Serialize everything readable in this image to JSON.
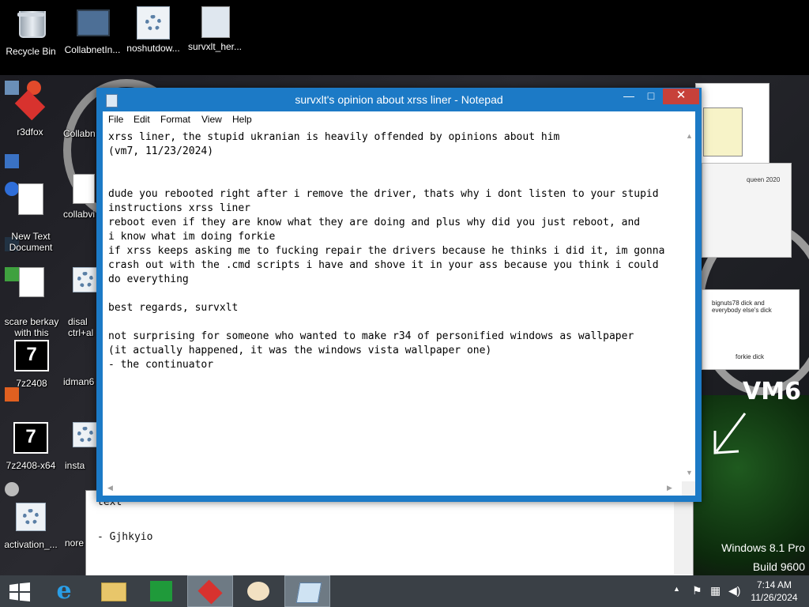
{
  "desktop": {
    "icons": [
      {
        "label": "Recycle Bin",
        "icon": "recycle-bin-icon"
      },
      {
        "label": "CollabnetIn...",
        "icon": "installer-icon"
      },
      {
        "label": "noshutdow...",
        "icon": "settings-gear-icon"
      },
      {
        "label": "survxlt_her...",
        "icon": "window-file-icon"
      }
    ],
    "side_icons": [
      {
        "label": "r3dfox"
      },
      {
        "label": "Collabn"
      },
      {
        "label": "New Text\nDocument"
      },
      {
        "label": "collabvi"
      },
      {
        "label": "scare berkay\nwith this"
      },
      {
        "label": "disal\nctrl+al"
      },
      {
        "label": "7z2408"
      },
      {
        "label": "idman6"
      },
      {
        "label": "7z2408-x64"
      },
      {
        "label": "insta"
      },
      {
        "label": "activation_..."
      },
      {
        "label": "nore"
      }
    ],
    "sketch_label": "VM6",
    "wallpaper_text": {
      "note1": "bignuts78 dick and everybody else's dick",
      "note2": "forkie dick",
      "note3": "queen 2020"
    },
    "watermark": {
      "line1": "Windows 8.1 Pro",
      "line2": "Build 9600"
    }
  },
  "background_notepad": {
    "lines": [
      "text",
      "",
      "- Gjhkyio"
    ]
  },
  "notepad": {
    "title": "survxlt's opinion about xrss liner - Notepad",
    "controls": {
      "minimize": "—",
      "maximize": "□",
      "close": "✕"
    },
    "menu": [
      "File",
      "Edit",
      "Format",
      "View",
      "Help"
    ],
    "lines": [
      "xrss liner, the stupid ukranian is heavily offended by opinions about him",
      "(vm7, 11/23/2024)",
      "",
      "",
      "dude you rebooted right after i remove the driver, thats why i dont listen to your stupid",
      "instructions xrss liner",
      "reboot even if they are know what they are doing and plus why did you just reboot, and",
      "i know what im doing forkie",
      "if xrss keeps asking me to fucking repair the drivers because he thinks i did it, im gonna",
      "crash out with the .cmd scripts i have and shove it in your ass because you think i could",
      "do everything",
      "",
      "best regards, survxlt",
      "",
      "not surprising for someone who wanted to make r34 of personified windows as wallpaper",
      "(it actually happened, it was the windows vista wallpaper one)",
      "- the continuator"
    ]
  },
  "taskbar": {
    "apps": [
      {
        "name": "start-button",
        "icon": "windows-logo-icon"
      },
      {
        "name": "internet-explorer",
        "icon": "internet-explorer-icon"
      },
      {
        "name": "file-explorer",
        "icon": "folder-icon"
      },
      {
        "name": "store",
        "icon": "store-icon"
      },
      {
        "name": "r3dfox",
        "icon": "r3dfox-icon"
      },
      {
        "name": "paint",
        "icon": "paint-palette-icon"
      },
      {
        "name": "notepad",
        "icon": "notepad-icon"
      }
    ],
    "clock": {
      "time": "7:14 AM",
      "date": "11/26/2024"
    },
    "tray_icons": [
      "show-hidden-icons",
      "action-center-flag-icon",
      "network-icon",
      "volume-icon"
    ],
    "colors": {
      "taskbar": "#3a4046",
      "titlebar": "#1c7ac6",
      "close": "#c7413a"
    }
  }
}
